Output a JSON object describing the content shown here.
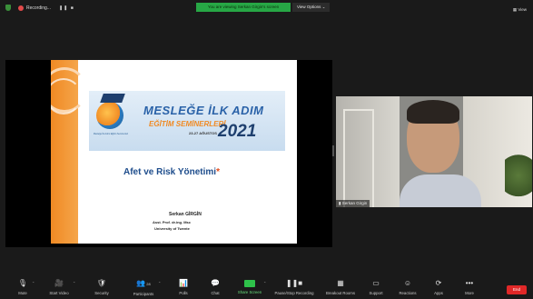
{
  "topbar": {
    "recording_label": "Recording...",
    "recording_controls": "❚❚ ■",
    "share_banner": "You are viewing Serkan Girgin's screen",
    "view_options": "View Options ⌄",
    "view_button": "▦ View"
  },
  "slide": {
    "banner_title": "MESLEĞE İLK ADIM",
    "banner_subtitle": "EĞİTİM SEMİNERLERİ",
    "banner_dates": "23-27 AĞUSTOS",
    "banner_year": "2021",
    "banner_logo_text": "Mesleğe İlk Adım Eğitim Seminerleri",
    "title": "Afet ve Risk Yönetimi",
    "title_mark": "*",
    "author_name": "Serkan GİRGİN",
    "author_title": "Asst. Prof. dr.ing. Msc",
    "author_affiliation": "University of Twente"
  },
  "video": {
    "participant_name": "Serkan Girgin"
  },
  "toolbar": {
    "items": [
      {
        "label": "Mute",
        "icon": "🎙"
      },
      {
        "label": "Start Video",
        "icon": "🎥"
      },
      {
        "label": "Security",
        "icon": "🛡"
      },
      {
        "label": "Participants",
        "icon": "👥",
        "count": "28"
      },
      {
        "label": "Polls",
        "icon": "📊"
      },
      {
        "label": "Chat",
        "icon": "💬"
      },
      {
        "label": "Share Screen",
        "icon": ""
      },
      {
        "label": "Pause/Stop Recording",
        "icon": "❚❚■"
      },
      {
        "label": "Breakout Rooms",
        "icon": "▦"
      },
      {
        "label": "Support",
        "icon": "▭"
      },
      {
        "label": "Reactions",
        "icon": "☺"
      },
      {
        "label": "Apps",
        "icon": "⟳"
      },
      {
        "label": "More",
        "icon": "•••"
      }
    ],
    "end_label": "End"
  },
  "colors": {
    "share_banner": "#27a745",
    "end_button": "#e02828",
    "slide_accent": "#f08a24",
    "slide_title": "#1e4d8c"
  }
}
